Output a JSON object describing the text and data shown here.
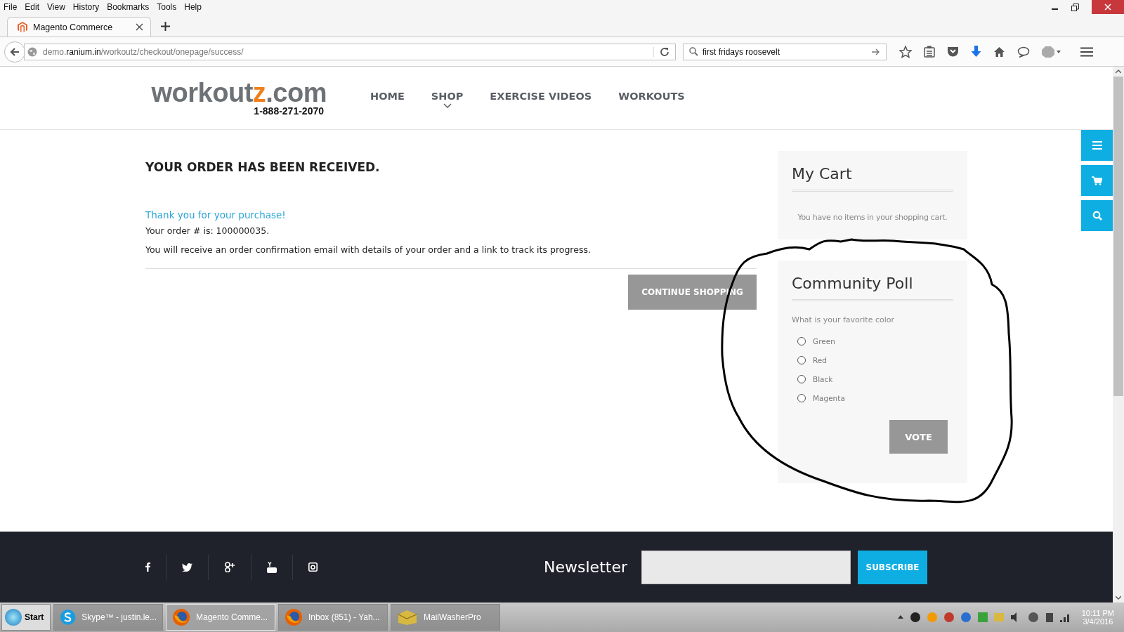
{
  "menu_bar": [
    "File",
    "Edit",
    "View",
    "History",
    "Bookmarks",
    "Tools",
    "Help"
  ],
  "tabs": [
    {
      "title": "Magento Commerce",
      "selected": true
    }
  ],
  "address_bar": {
    "host_prefix": "demo.",
    "host": "ranium.in",
    "path": "/workoutz/checkout/onepage/success/"
  },
  "search_bar": {
    "value": "first fridays roosevelt"
  },
  "site": {
    "logo_main": "workout",
    "logo_accent": "z",
    "logo_suffix": ".com",
    "phone": "1-888-271-2070",
    "nav": [
      {
        "label": "HOME",
        "dropdown": false
      },
      {
        "label": "SHOP",
        "dropdown": true
      },
      {
        "label": "EXERCISE VIDEOS",
        "dropdown": false
      },
      {
        "label": "WORKOUTS",
        "dropdown": false
      }
    ]
  },
  "order": {
    "heading": "YOUR ORDER HAS BEEN RECEIVED.",
    "thanks": "Thank you for your purchase!",
    "order_number": "Your order # is: 100000035.",
    "note": "You will receive an order confirmation email with details of your order and a link to track its progress.",
    "button": "CONTINUE SHOPPING"
  },
  "cart": {
    "title": "My Cart",
    "empty": "You have no items in your shopping cart."
  },
  "poll": {
    "title": "Community Poll",
    "question": "What is your favorite color",
    "options": [
      {
        "label": "Green",
        "selected": false
      },
      {
        "label": "Red",
        "selected": false
      },
      {
        "label": "Black",
        "selected": false
      },
      {
        "label": "Magenta",
        "selected": false
      }
    ],
    "button": "VOTE"
  },
  "side_buttons": [
    {
      "kind": "menu"
    },
    {
      "kind": "cart"
    },
    {
      "kind": "search"
    }
  ],
  "footer": {
    "social": [
      {
        "kind": "facebook"
      },
      {
        "kind": "twitter"
      },
      {
        "kind": "googleplus"
      },
      {
        "kind": "youtube"
      },
      {
        "kind": "instagram"
      }
    ],
    "newsletter_label": "Newsletter",
    "subscribe": "SUBSCRIBE"
  },
  "taskbar": {
    "start": "Start",
    "items": [
      {
        "kind": "skype",
        "label": "Skype™ - justin.le...",
        "selected": false
      },
      {
        "kind": "firefox",
        "label": "Magento Comme...",
        "selected": true
      },
      {
        "kind": "firefox",
        "label": "Inbox (851) - Yah...",
        "selected": false
      },
      {
        "kind": "mail",
        "label": "MailWasherPro",
        "selected": false
      }
    ],
    "time": "10:11 PM",
    "date": "3/4/2016"
  }
}
